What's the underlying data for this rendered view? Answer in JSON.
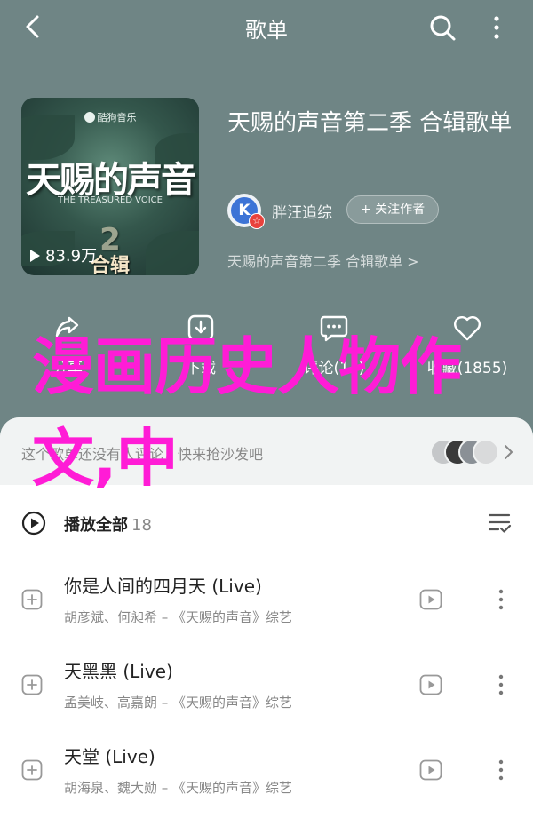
{
  "header": {
    "title": "歌单",
    "back_icon": "back-arrow-icon",
    "search_icon": "search-icon",
    "more_icon": "more-vertical-icon"
  },
  "cover": {
    "brand": "酷狗音乐",
    "title": "天赐的声音",
    "english": "THE TREASURED VOICE",
    "season": "合辑",
    "season_number": "2",
    "play_count": "83.9万"
  },
  "playlist": {
    "title": "天赐的声音第二季 合辑歌单",
    "creator": "胖汪追综",
    "creator_initial": "K",
    "follow_label": "+ 关注作者",
    "description": "天赐的声音第二季 合辑歌单 >"
  },
  "actions": [
    {
      "label": "分享",
      "icon": "share-icon"
    },
    {
      "label": "下载",
      "icon": "download-icon"
    },
    {
      "label": "评论(14)",
      "icon": "comment-icon"
    },
    {
      "label": "收藏(1855)",
      "icon": "heart-icon"
    }
  ],
  "overlay_text": "漫画历史人物作文,中",
  "comments": {
    "text": "这个歌单还没有人评论，快来抢沙发吧"
  },
  "list": {
    "play_all_label": "播放全部",
    "count": "18"
  },
  "songs": [
    {
      "title": "你是人间的四月天 (Live)",
      "subtitle": "胡彦斌、何昶希 – 《天赐的声音》综艺"
    },
    {
      "title": "天黑黑 (Live)",
      "subtitle": "孟美岐、高嘉朗 – 《天赐的声音》综艺"
    },
    {
      "title": "天堂 (Live)",
      "subtitle": "胡海泉、魏大勋 – 《天赐的声音》综艺"
    }
  ],
  "colors": {
    "background": "#6f8585",
    "overlay": "#ff1cd6",
    "accent": "#3d74d6"
  }
}
